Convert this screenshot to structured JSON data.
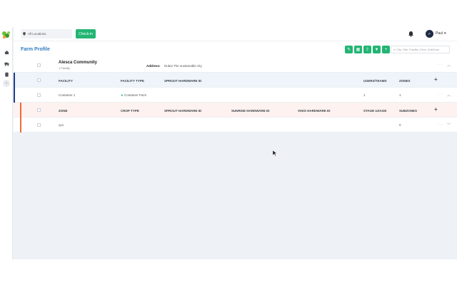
{
  "topbar": {
    "location_value": "All Locations",
    "checkin_label": "Check-in",
    "user_initial": "P",
    "user_name": "Paul"
  },
  "page": {
    "title": "Farm Profile",
    "search_placeholder": "City, Site, Facility, Zone, SubZone"
  },
  "community": {
    "name": "Alesca Community",
    "facility_count": "1 Facility",
    "address_label": "Address:",
    "address_value": "Dubai The sustainable city"
  },
  "facility_table": {
    "headers": [
      "FACILITY",
      "FACILITY TYPE",
      "SPROUT HARDWARE ID",
      "USERS/TEAMS",
      "ZONES"
    ],
    "row": {
      "facility": "Container 1",
      "type": "Container Farm",
      "users": "1",
      "zones": "1"
    }
  },
  "zone_table": {
    "headers": [
      "ZONE",
      "CROP TYPE",
      "SPROUT HARDWARE ID",
      "SUNRISE HARDWARE ID",
      "VISIO HARDWARE ID",
      "STAGE USAGE",
      "SUBZONES"
    ],
    "row": {
      "zone": "cp1",
      "subzones": "0"
    }
  },
  "icons": [
    "logo-icon",
    "home-icon",
    "truck-icon",
    "clipboard-icon",
    "chevron-right-icon",
    "pin-icon",
    "bell-icon",
    "caret-down-icon",
    "edit-icon",
    "grid-icon",
    "upload-icon",
    "filter-icon",
    "plus-icon",
    "search-icon",
    "ellipsis-icon",
    "chevron-up-icon",
    "chevron-down-icon",
    "play-icon"
  ],
  "colors": {
    "accent_green": "#22b573",
    "title_blue": "#2f7cc1",
    "facility_accent": "#1f3b8c",
    "zone_accent": "#f06a3b"
  }
}
